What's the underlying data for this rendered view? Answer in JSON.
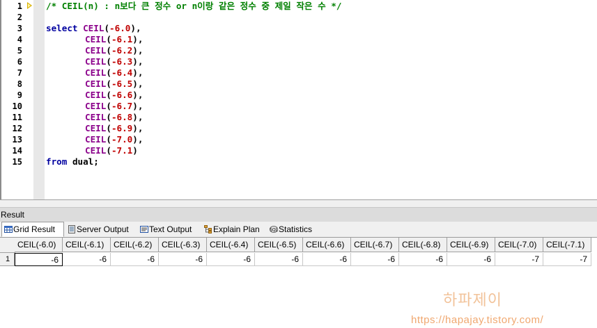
{
  "editor": {
    "line_numbers": [
      "1",
      "2",
      "3",
      "4",
      "5",
      "6",
      "7",
      "8",
      "9",
      "10",
      "11",
      "12",
      "13",
      "14",
      "15"
    ],
    "comment": "/* CEIL(n) : n보다 큰 정수 or n이랑 같은 정수 중 제일 작은 수 */",
    "select_keyword": "select",
    "function_name": "CEIL",
    "arguments": [
      "-6.0",
      "-6.1",
      "-6.2",
      "-6.3",
      "-6.4",
      "-6.5",
      "-6.6",
      "-6.7",
      "-6.8",
      "-6.9",
      "-7.0",
      "-7.1"
    ],
    "from_keyword": "from",
    "table_name": "dual"
  },
  "result_panel": {
    "title": "Result",
    "tabs": [
      {
        "label": "Grid Result",
        "icon": "grid-icon",
        "active": true
      },
      {
        "label": "Server Output",
        "icon": "server-output-icon",
        "active": false
      },
      {
        "label": "Text Output",
        "icon": "text-output-icon",
        "active": false
      },
      {
        "label": "Explain Plan",
        "icon": "explain-plan-icon",
        "active": false
      },
      {
        "label": "Statistics",
        "icon": "statistics-icon",
        "active": false
      }
    ],
    "grid": {
      "columns": [
        "CEIL(-6.0)",
        "CEIL(-6.1)",
        "CEIL(-6.2)",
        "CEIL(-6.3)",
        "CEIL(-6.4)",
        "CEIL(-6.5)",
        "CEIL(-6.6)",
        "CEIL(-6.7)",
        "CEIL(-6.8)",
        "CEIL(-6.9)",
        "CEIL(-7.0)",
        "CEIL(-7.1)"
      ],
      "rows": [
        {
          "row_number": "1",
          "values": [
            "-6",
            "-6",
            "-6",
            "-6",
            "-6",
            "-6",
            "-6",
            "-6",
            "-6",
            "-6",
            "-7",
            "-7"
          ]
        }
      ]
    }
  },
  "watermark": {
    "title": "하파제이",
    "url": "https://hapajay.tistory.com/"
  },
  "colors": {
    "keyword": "#0000a0",
    "function": "#8b008b",
    "number": "#c00000",
    "comment": "#008000",
    "watermark": "#f0a870"
  }
}
